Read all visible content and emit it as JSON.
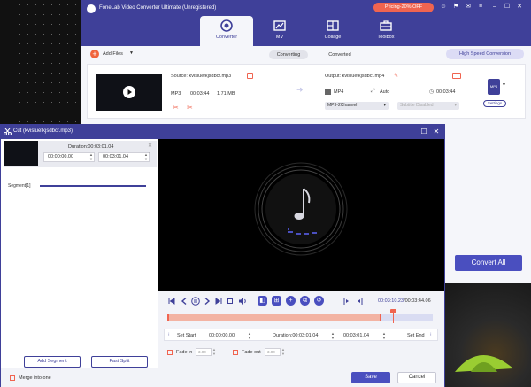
{
  "app": {
    "title": "FoneLab Video Converter Ultimate (Unregistered)",
    "promo": "Pricing-20% OFF",
    "tabs": [
      {
        "label": "Converter",
        "icon": "converter-icon"
      },
      {
        "label": "MV",
        "icon": "mv-icon"
      },
      {
        "label": "Collage",
        "icon": "collage-icon"
      },
      {
        "label": "Toolbox",
        "icon": "toolbox-icon"
      }
    ],
    "toolbar": {
      "add_files": "Add Files",
      "converting": "Converting",
      "converted": "Converted",
      "high_speed": "High Speed Conversion"
    },
    "file": {
      "source": "Source: kvisluefkjsdbcf.mp3",
      "format": "MP3",
      "duration": "00:03:44",
      "size": "1.71 MB",
      "output": "Output: kvisluefkjsdbcf.mp4",
      "out_format": "MP4",
      "out_res": "Auto",
      "out_duration": "00:03:44",
      "audio_select": "MP3-2Channel",
      "subtitle_select": "Subtitle Disabled",
      "badge": "MP4",
      "settings": "Settings"
    },
    "convert_all": "Convert All"
  },
  "cut": {
    "title": "Cut (kvisluefkjsdbcf.mp3)",
    "duration": "Duration:00:03:01.04",
    "start_time": "00:00:00.00",
    "end_time": "00:03:01.04",
    "segment_label": "Segment[1]",
    "add_segment": "Add Segment",
    "fast_split": "Fast Split",
    "timecode": "00:03:10.23/00:03:44.06",
    "set_start": "Set Start",
    "start_field": "00:00:00.00",
    "mid_duration": "Duration:00:03:01.04",
    "end_field": "00:03:01.04",
    "set_end": "Set End",
    "fade_in": "Fade in",
    "fade_in_val": "3.00",
    "fade_out": "Fade out",
    "fade_out_val": "3.00",
    "merge": "Merge into one",
    "save": "Save",
    "cancel": "Cancel",
    "playback_progress": 0.849,
    "selection": [
      0.0,
      0.807
    ]
  },
  "colors": {
    "brand": "#3f4099",
    "accent": "#f06450",
    "button": "#4a4fbf"
  }
}
